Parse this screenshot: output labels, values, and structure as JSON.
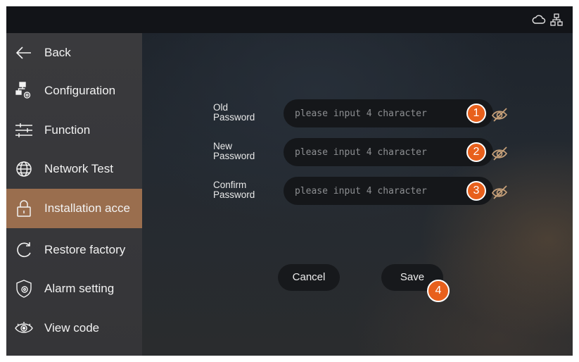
{
  "status_bar": {
    "icons": [
      "cloud-icon",
      "network-icon"
    ]
  },
  "sidebar": {
    "items": [
      {
        "label": "Back",
        "icon": "arrow-left-icon",
        "active": false
      },
      {
        "label": "Configuration",
        "icon": "configuration-icon",
        "active": false
      },
      {
        "label": "Function",
        "icon": "sliders-icon",
        "active": false
      },
      {
        "label": "Network Test",
        "icon": "globe-icon",
        "active": false
      },
      {
        "label": "Installation acce",
        "icon": "lock-icon",
        "active": true
      },
      {
        "label": "Restore factory",
        "icon": "restore-icon",
        "active": false
      },
      {
        "label": "Alarm setting",
        "icon": "shield-gear-icon",
        "active": false
      },
      {
        "label": "View code",
        "icon": "eye-icon",
        "active": false
      }
    ]
  },
  "form": {
    "old_password": {
      "label_line1": "Old",
      "label_line2": "Password",
      "placeholder": "please input 4 character",
      "callout": "1"
    },
    "new_password": {
      "label_line1": "New",
      "label_line2": "Password",
      "placeholder": "please input 4 character",
      "callout": "2"
    },
    "confirm_password": {
      "label_line1": "Confirm",
      "label_line2": "Password",
      "placeholder": "please input 4 character",
      "callout": "3"
    }
  },
  "actions": {
    "cancel_label": "Cancel",
    "save_label": "Save",
    "save_callout": "4"
  },
  "colors": {
    "accent": "#e8601c",
    "active_item": "#9a6e4e",
    "eye_icon": "#c9a27a"
  }
}
